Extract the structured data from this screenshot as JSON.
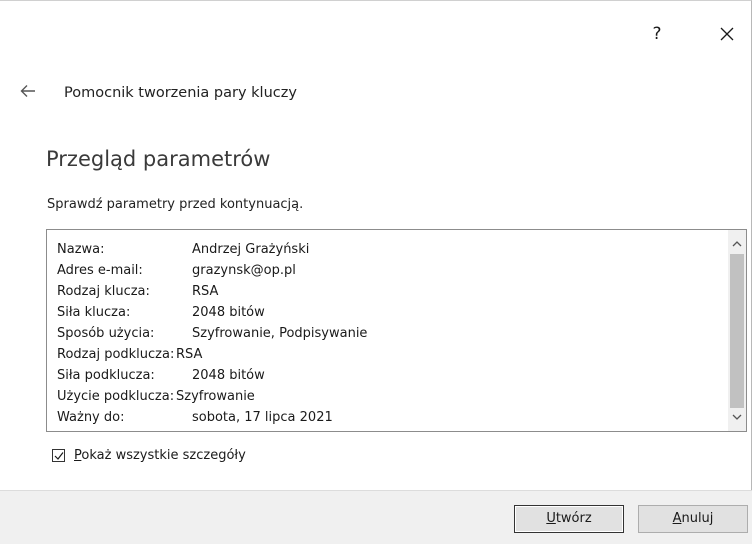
{
  "window": {
    "help_label": "?",
    "close_icon": "close-icon"
  },
  "wizard": {
    "title": "Pomocnik tworzenia pary kluczy",
    "back_icon": "arrow-left-icon"
  },
  "page": {
    "title": "Przegląd parametrów",
    "instruction": "Sprawdź parametry przed kontynuacją."
  },
  "summary": {
    "rows": [
      {
        "label": "Nazwa:",
        "value": "Andrzej Grażyński"
      },
      {
        "label": "Adres e-mail:",
        "value": "grazynsk@op.pl"
      },
      {
        "label": "Rodzaj klucza:",
        "value": "RSA"
      },
      {
        "label": "Siła klucza:",
        "value": "2048 bitów"
      },
      {
        "label": "Sposób użycia:",
        "value": "Szyfrowanie, Podpisywanie"
      },
      {
        "label": "Rodzaj podklucza:",
        "value": "RSA"
      },
      {
        "label": "Siła podklucza:",
        "value": "2048 bitów"
      },
      {
        "label": "Użycie podklucza:",
        "value": "Szyfrowanie"
      },
      {
        "label": "Ważny do:",
        "value": "sobota, 17 lipca 2021"
      }
    ]
  },
  "options": {
    "show_details_accel": "P",
    "show_details_rest": "okaż wszystkie szczegóły",
    "show_details_checked": true
  },
  "buttons": {
    "create_accel": "U",
    "create_rest": "twórz",
    "cancel_accel": "A",
    "cancel_rest": "nuluj"
  },
  "colors": {
    "footer": "#f0f0f0",
    "button_face": "#e1e1e1",
    "scroll_thumb": "#c1c1c1"
  }
}
